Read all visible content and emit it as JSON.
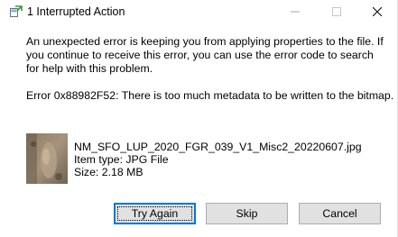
{
  "window": {
    "title": "1 Interrupted Action"
  },
  "dialog": {
    "message": "An unexpected error is keeping you from applying properties to the file. If you continue to receive this error, you can use the error code to search for help with this problem.",
    "error": "Error 0x88982F52: There is too much metadata to be written to the bitmap."
  },
  "file": {
    "name": "NM_SFO_LUP_2020_FGR_039_V1_Misc2_20220607.jpg",
    "type": "Item type: JPG File",
    "size": "Size: 2.18 MB"
  },
  "buttons": {
    "try_again": "Try Again",
    "skip": "Skip",
    "cancel": "Cancel"
  },
  "colors": {
    "accent": "#0078d7",
    "button_bg": "#e1e1e1",
    "button_border": "#adadad"
  },
  "icons": {
    "app": "file-transfer-icon",
    "minimize": "minimize-icon",
    "maximize": "maximize-icon",
    "close": "close-icon"
  }
}
